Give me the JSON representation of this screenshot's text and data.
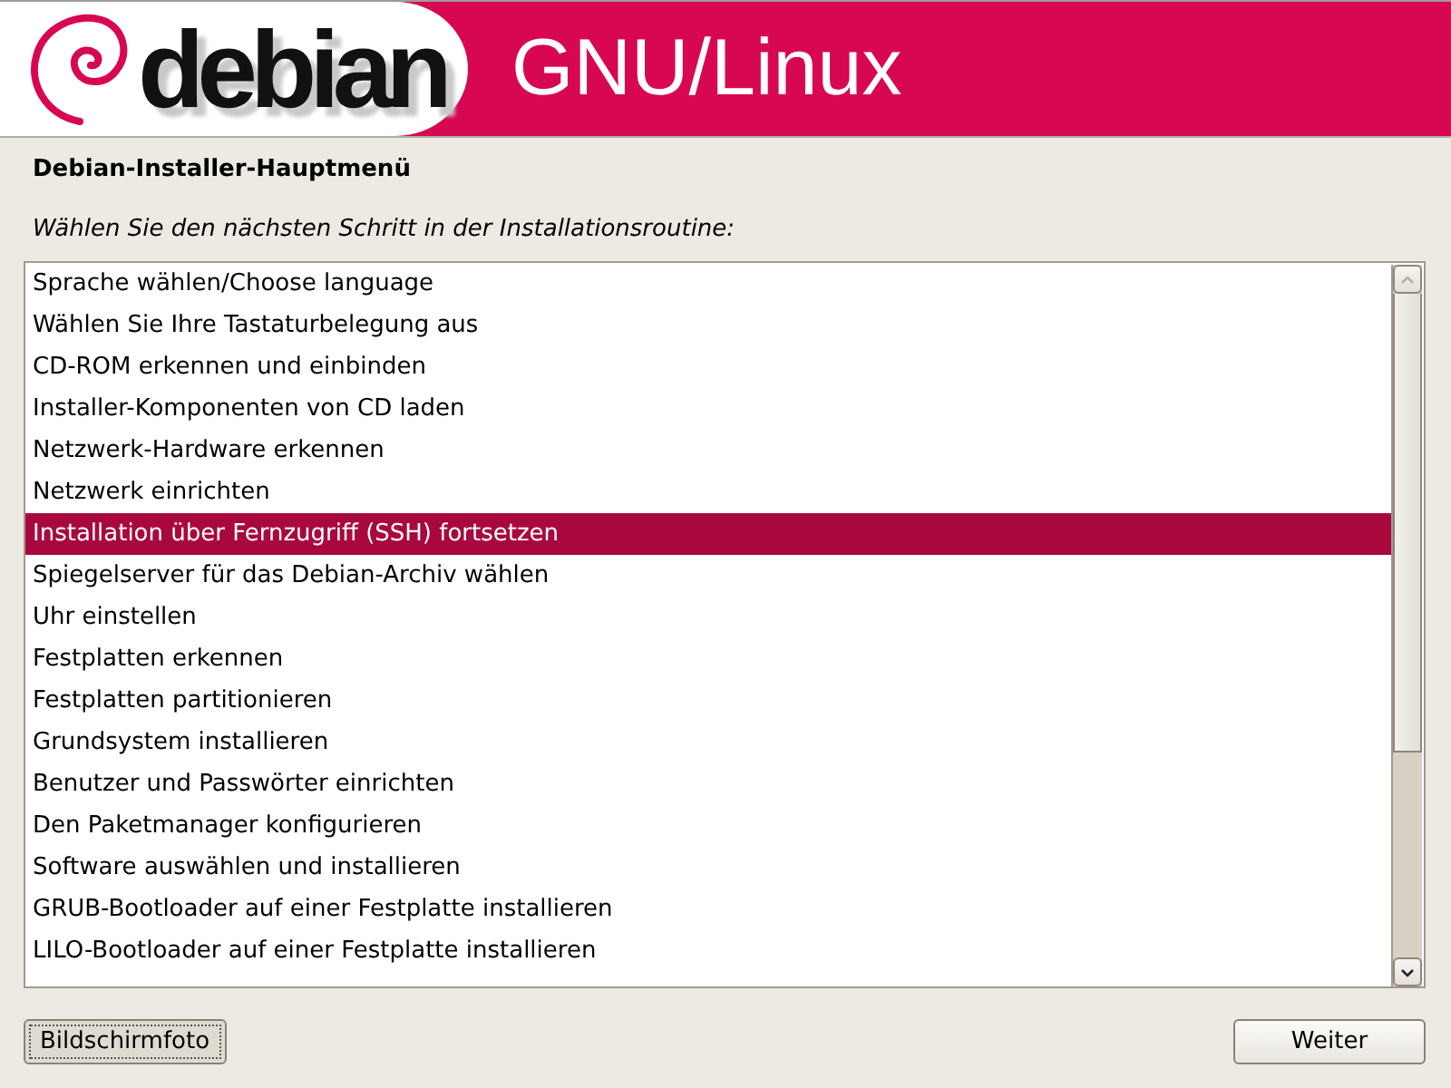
{
  "header": {
    "logo_text": "debian",
    "title": "GNU/Linux"
  },
  "heading": "Debian-Installer-Hauptmenü",
  "prompt": "Wählen Sie den nächsten Schritt in der Installationsroutine:",
  "menu": {
    "items": [
      {
        "label": "Sprache wählen/Choose language",
        "selected": false
      },
      {
        "label": "Wählen Sie Ihre Tastaturbelegung aus",
        "selected": false
      },
      {
        "label": "CD-ROM erkennen und einbinden",
        "selected": false
      },
      {
        "label": "Installer-Komponenten von CD laden",
        "selected": false
      },
      {
        "label": "Netzwerk-Hardware erkennen",
        "selected": false
      },
      {
        "label": "Netzwerk einrichten",
        "selected": false
      },
      {
        "label": "Installation über Fernzugriff (SSH) fortsetzen",
        "selected": true
      },
      {
        "label": "Spiegelserver für das Debian-Archiv wählen",
        "selected": false
      },
      {
        "label": "Uhr einstellen",
        "selected": false
      },
      {
        "label": "Festplatten erkennen",
        "selected": false
      },
      {
        "label": "Festplatten partitionieren",
        "selected": false
      },
      {
        "label": "Grundsystem installieren",
        "selected": false
      },
      {
        "label": "Benutzer und Passwörter einrichten",
        "selected": false
      },
      {
        "label": "Den Paketmanager konfigurieren",
        "selected": false
      },
      {
        "label": "Software auswählen und installieren",
        "selected": false
      },
      {
        "label": "GRUB-Bootloader auf einer Festplatte installieren",
        "selected": false
      },
      {
        "label": "LILO-Bootloader auf einer Festplatte installieren",
        "selected": false
      }
    ]
  },
  "buttons": [
    {
      "label": "Bildschirmfoto",
      "focused": true
    },
    {
      "label": "Weiter",
      "focused": false
    }
  ]
}
